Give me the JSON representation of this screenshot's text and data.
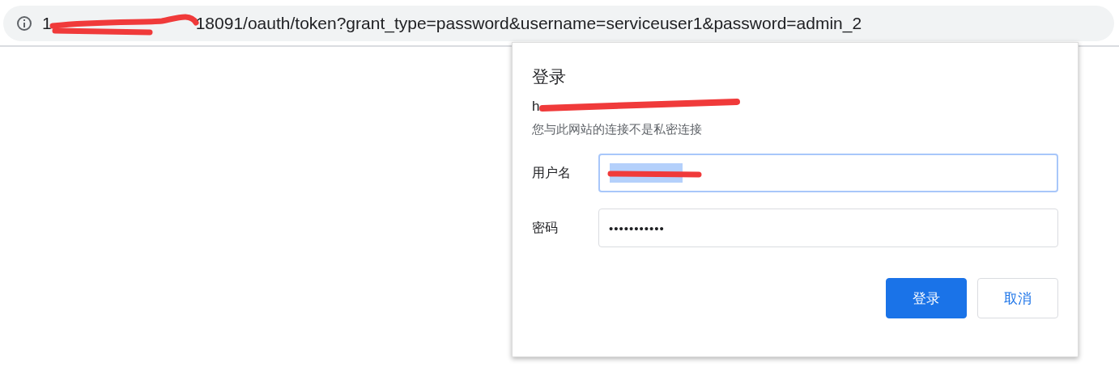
{
  "address_bar": {
    "url_start": "1",
    "url_end": "18091/oauth/token?grant_type=password&username=serviceuser1&password=admin_2"
  },
  "dialog": {
    "title": "登录",
    "origin_start": "h",
    "warning": "您与此网站的连接不是私密连接",
    "fields": [
      {
        "label": "用户名",
        "kind": "text",
        "focused": true,
        "value_selected": true
      },
      {
        "label": "密码",
        "kind": "password",
        "focused": false,
        "value": "•••••••••••"
      }
    ],
    "buttons": [
      {
        "label": "登录",
        "primary": true
      },
      {
        "label": "取消",
        "primary": false
      }
    ]
  }
}
